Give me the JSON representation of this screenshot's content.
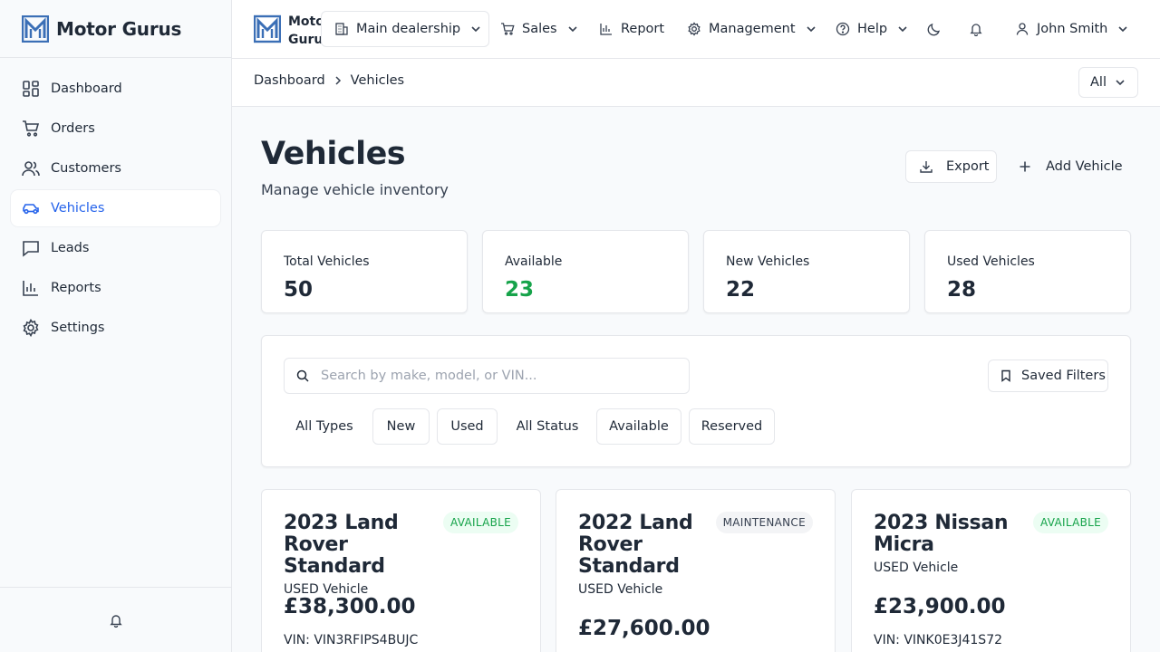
{
  "brand": {
    "name": "Motor Gurus",
    "short_line1": "Motor",
    "short_line2": "Gurus"
  },
  "colors": {
    "accent": "#2563eb",
    "available": "#16a34a",
    "logo": "#3b6fb6"
  },
  "sidebar": {
    "items": [
      {
        "label": "Dashboard",
        "icon": "dashboard-icon"
      },
      {
        "label": "Orders",
        "icon": "cart-icon"
      },
      {
        "label": "Customers",
        "icon": "users-icon"
      },
      {
        "label": "Vehicles",
        "icon": "car-icon",
        "active": true
      },
      {
        "label": "Leads",
        "icon": "chat-icon"
      },
      {
        "label": "Reports",
        "icon": "bar-chart-icon"
      },
      {
        "label": "Settings",
        "icon": "gear-icon"
      }
    ],
    "footer_icon": "bell-icon"
  },
  "topbar": {
    "dealership": "Main dealership",
    "sales": "Sales",
    "report": "Report",
    "management": "Management",
    "help": "Help",
    "user": "John Smith"
  },
  "breadcrumb": {
    "home": "Dashboard",
    "current": "Vehicles"
  },
  "scope_select": "All",
  "page": {
    "title": "Vehicles",
    "subtitle": "Manage vehicle inventory",
    "export_label": "Export",
    "add_label": "Add Vehicle"
  },
  "stats": [
    {
      "label": "Total Vehicles",
      "value": "50"
    },
    {
      "label": "Available",
      "value": "23"
    },
    {
      "label": "New Vehicles",
      "value": "22"
    },
    {
      "label": "Used Vehicles",
      "value": "28"
    }
  ],
  "filters": {
    "search_placeholder": "Search by make, model, or VIN...",
    "saved_label": "Saved Filters",
    "chips": [
      "All Types",
      "New",
      "Used",
      "All Status",
      "Available",
      "Reserved"
    ]
  },
  "vehicles": [
    {
      "title": "2023 Land Rover Standard",
      "type": "USED Vehicle",
      "status": "AVAILABLE",
      "price": "£38,300.00",
      "vin": "VIN: VIN3RFIPS4BUJC"
    },
    {
      "title": "2022 Land Rover Standard",
      "type": "USED Vehicle",
      "status": "MAINTENANCE",
      "price": "£27,600.00",
      "vin": ""
    },
    {
      "title": "2023 Nissan Micra",
      "type": "USED Vehicle",
      "status": "AVAILABLE",
      "price": "£23,900.00",
      "vin": "VIN: VINK0E3J41S72"
    }
  ]
}
